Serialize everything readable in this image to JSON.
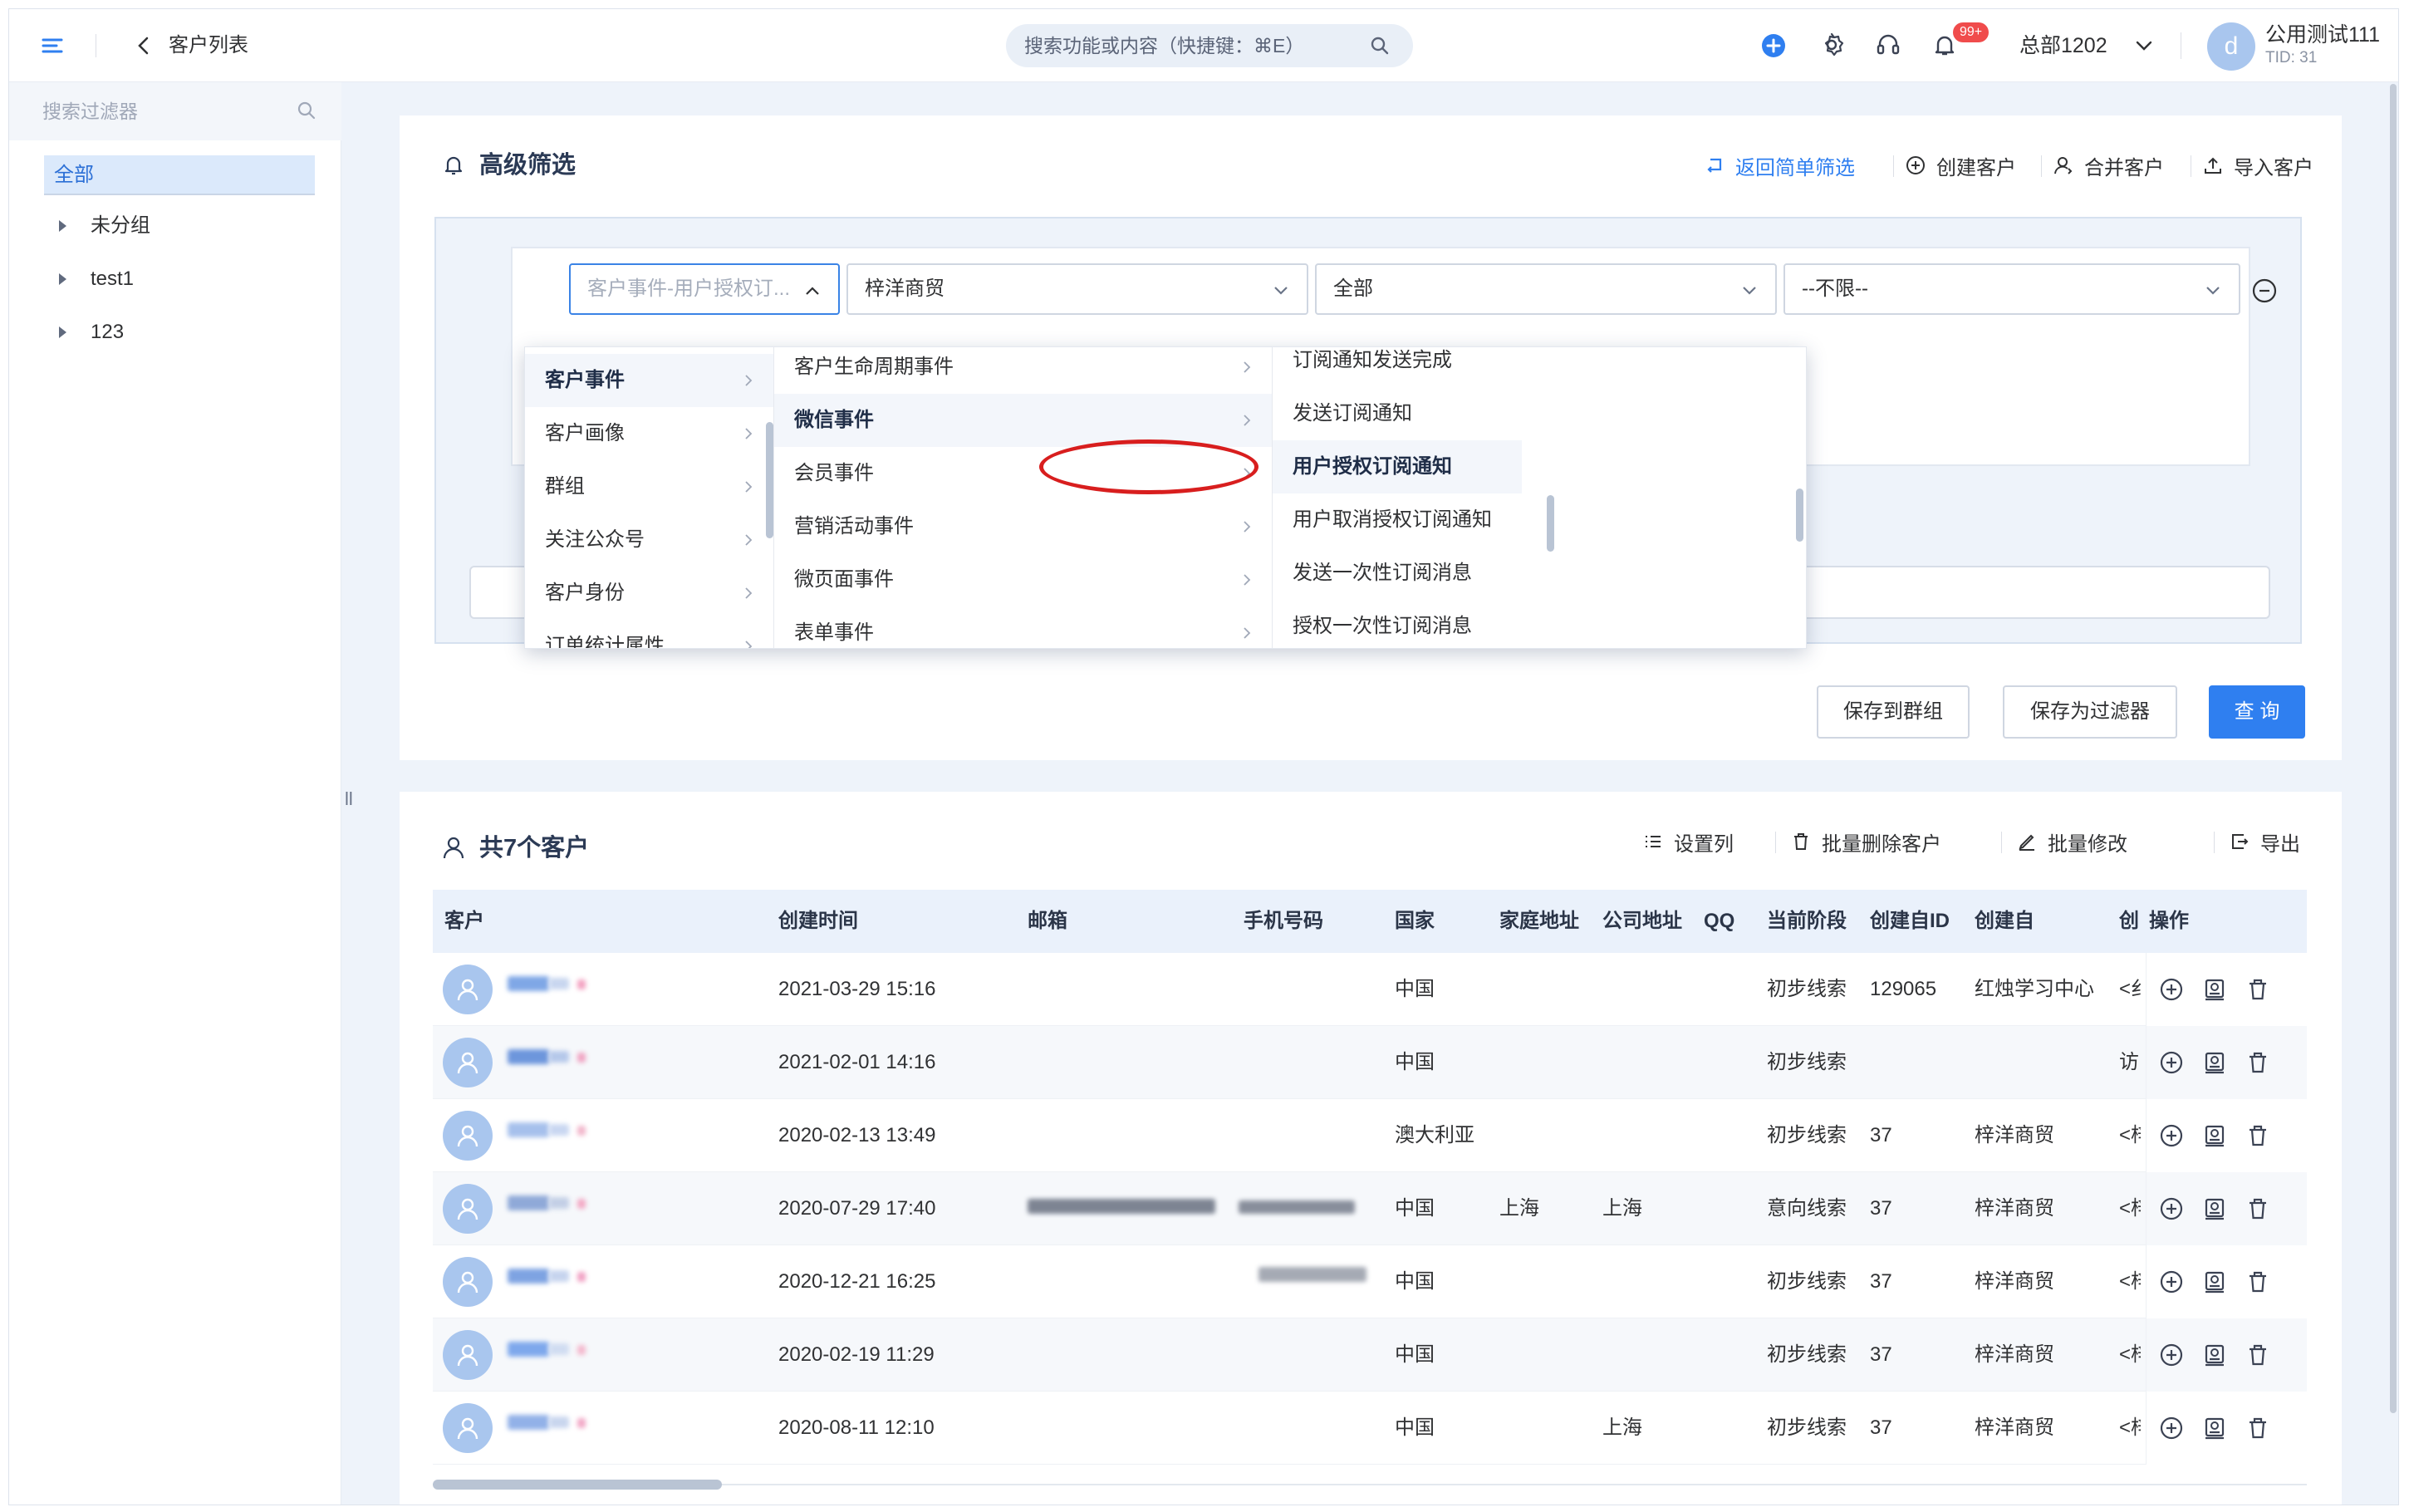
{
  "header": {
    "page_title": "客户列表",
    "search_placeholder": "搜索功能或内容（快捷键：⌘E）",
    "notification_badge": "99+",
    "org_name": "总部1202",
    "avatar_letter": "d",
    "user_name": "公用测试111",
    "user_tid": "TID: 31"
  },
  "sidebar": {
    "search_placeholder": "搜索过滤器",
    "all_label": "全部",
    "items": [
      {
        "label": "未分组"
      },
      {
        "label": "test1"
      },
      {
        "label": "123"
      }
    ]
  },
  "filter_card": {
    "title": "高级筛选",
    "actions": [
      {
        "label": "返回简单筛选",
        "icon": "return-icon"
      },
      {
        "label": "创建客户",
        "icon": "plus-circle-icon"
      },
      {
        "label": "合并客户",
        "icon": "merge-user-icon"
      },
      {
        "label": "导入客户",
        "icon": "upload-icon"
      }
    ],
    "selects": {
      "event_placeholder": "客户事件-用户授权订...",
      "company": "梓洋商贸",
      "scope": "全部",
      "limit": "--不限--"
    },
    "cascader": {
      "level1": [
        {
          "label": "客户事件"
        },
        {
          "label": "客户画像"
        },
        {
          "label": "群组"
        },
        {
          "label": "关注公众号"
        },
        {
          "label": "客户身份"
        },
        {
          "label": "订单统计属性"
        }
      ],
      "level2": [
        {
          "label": "客户生命周期事件"
        },
        {
          "label": "微信事件"
        },
        {
          "label": "会员事件"
        },
        {
          "label": "营销活动事件"
        },
        {
          "label": "微页面事件"
        },
        {
          "label": "表单事件"
        }
      ],
      "level3": [
        {
          "label": "订阅通知发送完成"
        },
        {
          "label": "发送订阅通知"
        },
        {
          "label": "用户授权订阅通知"
        },
        {
          "label": "用户取消授权订阅通知"
        },
        {
          "label": "发送一次性订阅消息"
        },
        {
          "label": "授权一次性订阅消息"
        }
      ]
    },
    "buttons": {
      "save_group": "保存到群组",
      "save_filter": "保存为过滤器",
      "query": "查 询"
    }
  },
  "customer_card": {
    "title": "共7个客户",
    "actions": [
      {
        "label": "设置列",
        "icon": "list-icon"
      },
      {
        "label": "批量删除客户",
        "icon": "trash-icon"
      },
      {
        "label": "批量修改",
        "icon": "edit-icon"
      },
      {
        "label": "导出",
        "icon": "export-icon"
      }
    ],
    "columns": [
      "客户",
      "创建时间",
      "邮箱",
      "手机号码",
      "国家",
      "家庭地址",
      "公司地址",
      "QQ",
      "当前阶段",
      "创建自ID",
      "创建自",
      "创",
      "操作"
    ],
    "rows": [
      {
        "created": "2021-03-29 15:16",
        "country": "中国",
        "home": "",
        "company_addr": "",
        "stage": "初步线索",
        "src_id": "129065",
        "src": "红烛学习中心",
        "extra": "<纟"
      },
      {
        "created": "2021-02-01 14:16",
        "country": "中国",
        "home": "",
        "company_addr": "",
        "stage": "初步线索",
        "src_id": "",
        "src": "",
        "extra": "访|"
      },
      {
        "created": "2020-02-13 13:49",
        "country": "澳大利亚",
        "home": "",
        "company_addr": "",
        "stage": "初步线索",
        "src_id": "37",
        "src": "梓洋商贸",
        "extra": "<梓"
      },
      {
        "created": "2020-07-29 17:40",
        "country": "中国",
        "home": "上海",
        "company_addr": "上海",
        "stage": "意向线索",
        "src_id": "37",
        "src": "梓洋商贸",
        "extra": "<梓"
      },
      {
        "created": "2020-12-21 16:25",
        "country": "中国",
        "home": "",
        "company_addr": "",
        "stage": "初步线索",
        "src_id": "37",
        "src": "梓洋商贸",
        "extra": "<梓"
      },
      {
        "created": "2020-02-19 11:29",
        "country": "中国",
        "home": "",
        "company_addr": "",
        "stage": "初步线索",
        "src_id": "37",
        "src": "梓洋商贸",
        "extra": "<梓"
      },
      {
        "created": "2020-08-11 12:10",
        "country": "中国",
        "home": "",
        "company_addr": "上海",
        "stage": "初步线索",
        "src_id": "37",
        "src": "梓洋商贸",
        "extra": "<梓"
      }
    ]
  },
  "colors": {
    "accent": "#2f7ff0",
    "highlight": "#d81e1e",
    "badge": "#f04c4c"
  }
}
